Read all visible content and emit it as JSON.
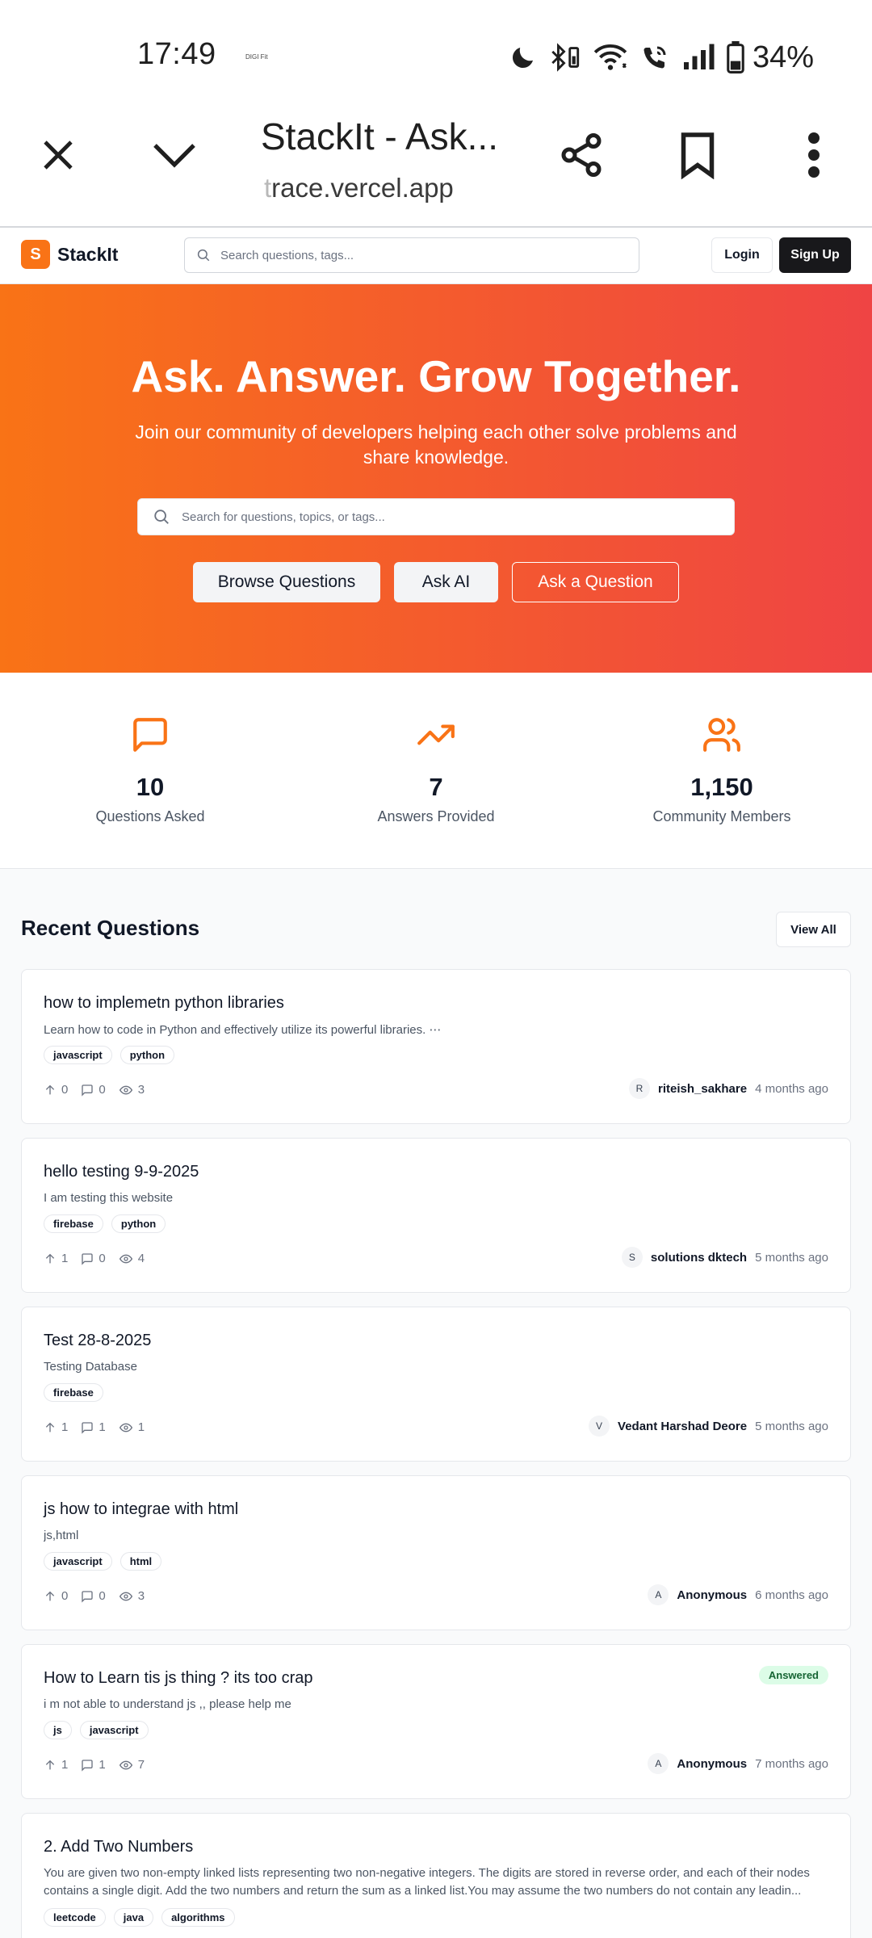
{
  "status_bar": {
    "time": "17:49",
    "small_text": "DIGI Fit",
    "battery": "34%"
  },
  "browser": {
    "title": "StackIt - Ask...",
    "url_faded": "t",
    "url_rest": "race.vercel.app"
  },
  "nav": {
    "logo_letter": "S",
    "logo_text": "StackIt",
    "search_placeholder": "Search questions, tags...",
    "login": "Login",
    "signup": "Sign Up"
  },
  "hero": {
    "title": "Ask. Answer. Grow Together.",
    "subtitle": "Join our community of developers helping each other solve problems and share knowledge.",
    "search_placeholder": "Search for questions, topics, or tags...",
    "browse": "Browse Questions",
    "ask_ai": "Ask AI",
    "ask_question": "Ask a Question",
    "gradient_start": "#f97316",
    "gradient_end": "#ef4444"
  },
  "stats": [
    {
      "icon": "message-square-icon",
      "value": "10",
      "label": "Questions Asked"
    },
    {
      "icon": "trending-up-icon",
      "value": "7",
      "label": "Answers Provided"
    },
    {
      "icon": "users-icon",
      "value": "1,150",
      "label": "Community Members"
    }
  ],
  "recent": {
    "title": "Recent Questions",
    "view_all": "View All",
    "questions": [
      {
        "title": "how to implemetn python libraries",
        "description": "Learn how to code in Python and effectively utilize its powerful libraries. ⋯",
        "tags": [
          "javascript",
          "python"
        ],
        "votes": "0",
        "answers": "0",
        "views": "3",
        "avatar": "R",
        "author": "riteish_sakhare",
        "time": "4 months ago"
      },
      {
        "title": "hello testing 9-9-2025",
        "description": "I am testing this website",
        "tags": [
          "firebase",
          "python"
        ],
        "votes": "1",
        "answers": "0",
        "views": "4",
        "avatar": "S",
        "author": "solutions dktech",
        "time": "5 months ago"
      },
      {
        "title": "Test 28-8-2025",
        "description": "Testing Database",
        "tags": [
          "firebase"
        ],
        "votes": "1",
        "answers": "1",
        "views": "1",
        "avatar": "V",
        "author": "Vedant Harshad Deore",
        "time": "5 months ago"
      },
      {
        "title": "js how to integrae with html",
        "description": "js,html",
        "tags": [
          "javascript",
          "html"
        ],
        "votes": "0",
        "answers": "0",
        "views": "3",
        "avatar": "A",
        "author": "Anonymous",
        "time": "6 months ago"
      },
      {
        "title": "How to Learn tis js thing ? its too crap",
        "description": "i m not able to understand js ,, please help me",
        "tags": [
          "js",
          "javascript"
        ],
        "votes": "1",
        "answers": "1",
        "views": "7",
        "avatar": "A",
        "author": "Anonymous",
        "time": "7 months ago",
        "badge": "Answered"
      },
      {
        "title": "2. Add Two Numbers",
        "description": "You are given two non-empty linked lists representing two non-negative integers. The digits are stored in reverse order, and each of their nodes contains a single digit. Add the two numbers and return the sum as a linked list.You may assume the two numbers do not contain any leadin...",
        "tags": [
          "leetcode",
          "java",
          "algorithms"
        ]
      }
    ]
  }
}
